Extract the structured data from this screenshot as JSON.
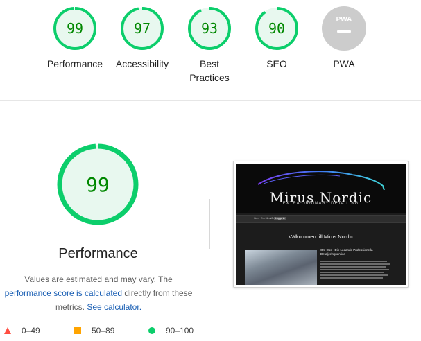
{
  "colors": {
    "pass": "#0cce6b",
    "pass_text": "#008800",
    "pass_bg": "#e8f8ef",
    "average": "#ffa400",
    "fail": "#ff4e42",
    "pwa_gray": "#cccccc",
    "link": "#1a5fb4"
  },
  "gauges": [
    {
      "score": "99",
      "score_fraction": 0.99,
      "label": "Performance"
    },
    {
      "score": "97",
      "score_fraction": 0.97,
      "label": "Accessibility"
    },
    {
      "score": "93",
      "score_fraction": 0.93,
      "label_line1": "Best",
      "label_line2": "Practices"
    },
    {
      "score": "90",
      "score_fraction": 0.9,
      "label": "SEO"
    },
    {
      "score": "",
      "badge_text": "PWA",
      "label": "PWA",
      "icon": "pwa-badge-icon"
    }
  ],
  "performance": {
    "score": "99",
    "score_fraction": 0.99,
    "title": "Performance",
    "desc_part1": "Values are estimated and may vary. The",
    "link1": "performance score is calculated",
    "desc_part2": "directly from these metrics.",
    "link2": "See calculator."
  },
  "screenshot": {
    "brand": "Mirus Nordic",
    "tagline": "EXTRA ORDINARY DETAILING",
    "nav": [
      "Hem",
      "Om Mirus",
      "Våra tjänster",
      "Logga in"
    ],
    "welcome": "Välkommen till Mirus Nordic",
    "headline_line1": "Om Oss - Din Ledande Professionella",
    "headline_line2": "Detaljeringservice"
  },
  "legend": [
    {
      "range": "0–49",
      "icon": "fail-triangle-icon"
    },
    {
      "range": "50–89",
      "icon": "average-square-icon"
    },
    {
      "range": "90–100",
      "icon": "pass-circle-icon"
    }
  ]
}
